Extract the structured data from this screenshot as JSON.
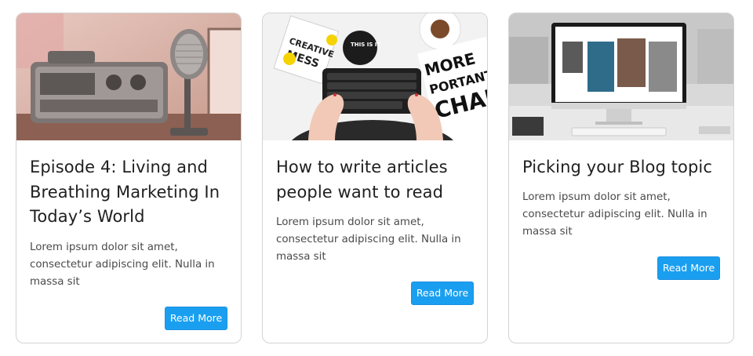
{
  "cards": [
    {
      "title": "Episode 4: Living and Breathing Marketing In Today’s World",
      "excerpt": "Lorem ipsum dolor sit amet, consectetur adipiscing elit. Nulla in massa sit",
      "button_label": "Read More"
    },
    {
      "title": "How to write articles people want to read",
      "excerpt": "Lorem ipsum dolor sit amet, consectetur adipiscing elit. Nulla in massa sit",
      "button_label": "Read More",
      "image_text": {
        "sticker1": "CREATIVE",
        "sticker2": "MESS",
        "sticker3": "THIS IS IT",
        "poster1": "MORE",
        "poster2": "PORTANT",
        "poster3": "CHAN"
      }
    },
    {
      "title": "Picking your Blog topic",
      "excerpt": "Lorem ipsum dolor sit amet, consectetur adipiscing elit. Nulla in massa sit",
      "button_label": "Read More"
    }
  ],
  "colors": {
    "button": "#1a9ff0",
    "title": "#1f1f1f",
    "excerpt": "#4a4a4a",
    "card_border": "#d3d3d3"
  }
}
